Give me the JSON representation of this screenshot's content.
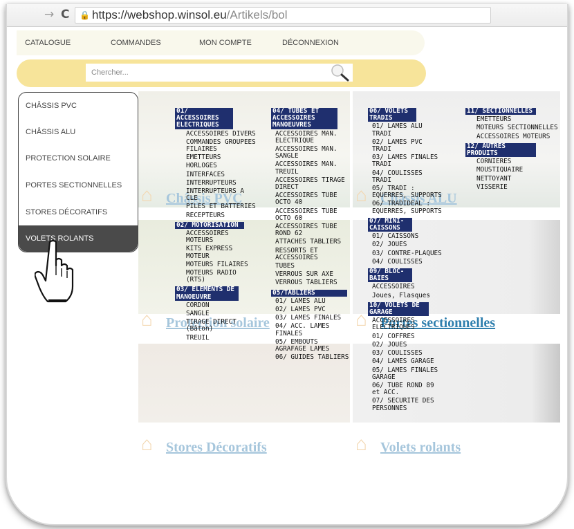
{
  "browser": {
    "url_host": "https://webshop.winsol.eu",
    "url_path": "/Artikels/bol"
  },
  "topmenu": [
    "CATALOGUE",
    "COMMANDES",
    "MON COMPTE",
    "DÉCONNEXION"
  ],
  "search": {
    "placeholder": "Chercher..."
  },
  "sidebar": [
    {
      "label": "CHÂSSIS PVC"
    },
    {
      "label": "CHÂSSIS ALU"
    },
    {
      "label": "PROTECTION SOLAIRE"
    },
    {
      "label": "PORTES SECTIONNELLES"
    },
    {
      "label": "STORES DÉCORATIFS"
    },
    {
      "label": "VOLETS ROLANTS"
    }
  ],
  "tiles": [
    {
      "label": "Châssis PVC"
    },
    {
      "label": "Châssis ALU"
    },
    {
      "label": "Protection solaire"
    },
    {
      "label": "Portes sectionnelles"
    },
    {
      "label": "Stores Décoratifs"
    },
    {
      "label": "Volets rolants"
    }
  ],
  "columns": [
    [
      {
        "title": "01/ ACCESSOIRES ELECTRIQUES",
        "items": [
          "ACCESSOIRES DIVERS",
          "COMMANDES GROUPEES FILAIRES",
          "EMETTEURS",
          "HORLOGES",
          "INTERFACES",
          "INTERRUPTEURS",
          "INTERRUPTEURS A CLE",
          "PILES ET BATTERIES",
          "RECEPTEURS"
        ]
      },
      {
        "title": "02/ MOTORISATION",
        "items": [
          "ACCESSOIRES MOTEURS",
          "KITS EXPRESS MOTEUR",
          "MOTEURS FILAIRES",
          "MOTEURS RADIO (RTS)"
        ]
      },
      {
        "title": "03/ ELEMENTS DE MANOEUVRE",
        "items": [
          "CORDON",
          "SANGLE",
          "TIRAGE DIRECT (Bâton)",
          "TREUIL"
        ]
      }
    ],
    [
      {
        "title": "04/ TUBES ET ACCESSOIRES MANOEUVRES",
        "items": [
          "ACCESSOIRES MAN. ELECTRIQUE",
          "ACCESSOIRES MAN. SANGLE",
          "ACCESSOIRES MAN. TREUIL",
          "ACCESSOIRES TIRAGE DIRECT",
          "ACCESSOIRES TUBE OCTO 40",
          "ACCESSOIRES TUBE OCTO 60",
          "ACCESSOIRES TUBE ROND 62",
          "ATTACHES TABLIERS",
          "RESSORTS ET ACCESSOIRES",
          "TUBES",
          "VERROUS SUR AXE",
          "VERROUS TABLIERS"
        ]
      },
      {
        "title": "05/TABLIERS",
        "items": [
          "01/ LAMES ALU",
          "02/ LAMES PVC",
          "03/ LAMES FINALES",
          "04/ ACC. LAMES FINALES",
          "05/ EMBOUTS AGRAFAGE LAMES",
          "06/ GUIDES TABLIERS"
        ]
      }
    ],
    [
      {
        "title": "06/ VOLETS TRADIS",
        "items": [
          "01/ LAMES ALU TRADI",
          "02/ LAMES PVC TRADI",
          "03/ LAMES FINALES TRADI",
          "04/ COULISSES TRADI",
          "05/ TRADI : EQUERRES, SUPPORTS",
          "06/ TRADIDEAL : EQUERRES, SUPPORTS"
        ]
      },
      {
        "title": "07/ MINI-CAISSONS",
        "items": [
          "01/ CAISSONS",
          "02/ JOUES",
          "03/ CONTRE-PLAQUES",
          "04/ COULISSES"
        ]
      },
      {
        "title": "09/ BLOC-BAIES",
        "items": [
          "ACCESSOIRES",
          "Joues, Flasques"
        ]
      },
      {
        "title": "10/ VOLETS DE GARAGE",
        "items": [
          "ACCESSOIRES ELECTRIQUES",
          "01/ COFFRES",
          "02/ JOUES",
          "03/ COULISSES",
          "04/ LAMES GARAGE",
          "05/ LAMES FINALES GARAGE",
          "06/ TUBE ROND 89 et ACC.",
          "07/ SECURITE DES PERSONNES"
        ]
      }
    ],
    [
      {
        "title": "11/ SECTIONNELLES",
        "items": [
          "EMETTEURS",
          "MOTEURS SECTIONNELLES",
          "ACCESSOIRES MOTEURS"
        ]
      },
      {
        "title": "12/ AUTRES PRODUITS",
        "items": [
          "CORNIERES",
          "MOUSTIQUAIRE",
          "NETTOYANT",
          "VISSERIE"
        ]
      }
    ]
  ]
}
